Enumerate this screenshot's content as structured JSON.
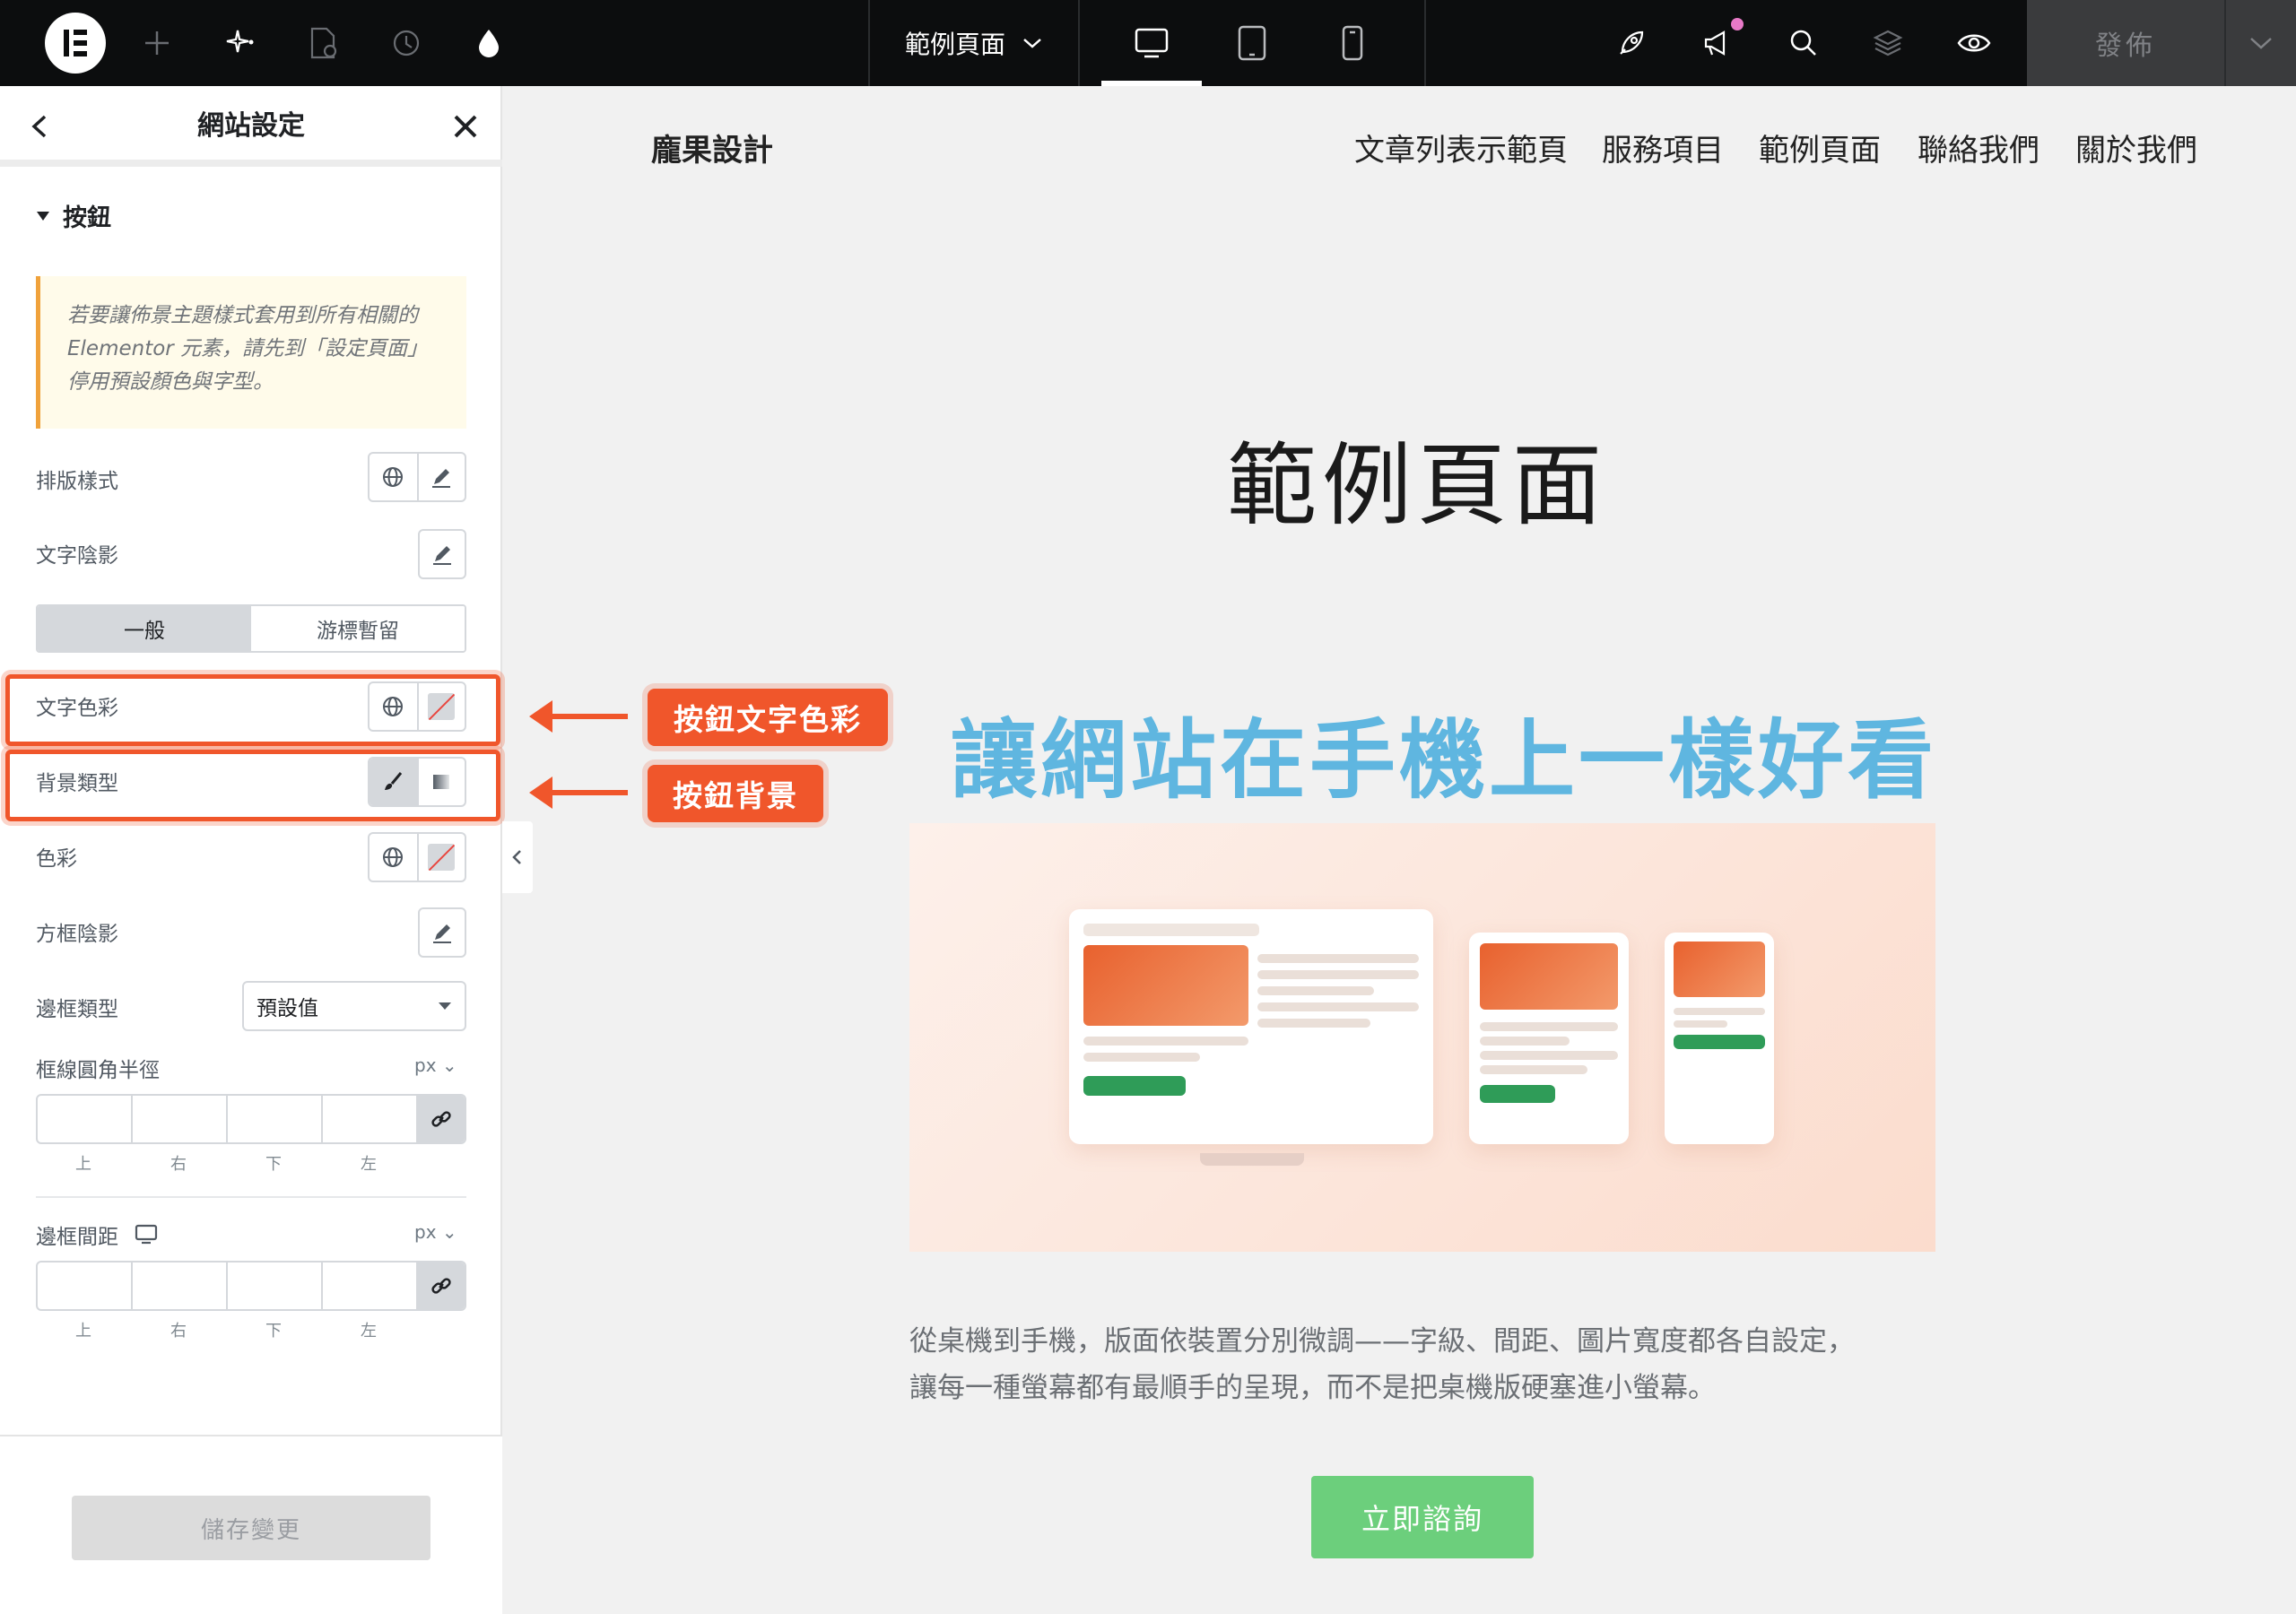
{
  "topbar": {
    "page_name": "範例頁面",
    "publish_label": "發佈"
  },
  "panel": {
    "title": "網站設定",
    "section_title": "按鈕",
    "notice": "若要讓佈景主題樣式套用到所有相關的 Elementor 元素，請先到「設定頁面」停用預設顏色與字型。",
    "typography_label": "排版樣式",
    "text_shadow_label": "文字陰影",
    "tabs": [
      "一般",
      "游標暫留"
    ],
    "text_color_label": "文字色彩",
    "background_type_label": "背景類型",
    "color_label": "色彩",
    "box_shadow_label": "方框陰影",
    "border_type_label": "邊框類型",
    "border_type_value": "預設值",
    "border_radius_label": "框線圓角半徑",
    "padding_label": "邊框間距",
    "unit": "px",
    "dim_labels": [
      "上",
      "右",
      "下",
      "左"
    ],
    "save_label": "儲存變更"
  },
  "site": {
    "brand": "龐果設計",
    "nav": [
      "文章列表示範頁",
      "服務項目",
      "範例頁面",
      "聯絡我們",
      "關於我們"
    ],
    "hero_title": "範例頁面",
    "tagline": "讓網站在手機上一樣好看",
    "paragraph_line1": "從桌機到手機，版面依裝置分別微調——字級、間距、圖片寬度都各自設定，",
    "paragraph_line2": "讓每一種螢幕都有最順手的呈現，而不是把桌機版硬塞進小螢幕。",
    "cta": "立即諮詢"
  },
  "callouts": {
    "text_color": "按鈕文字色彩",
    "background": "按鈕背景"
  },
  "colors": {
    "accent": "#f0562b",
    "tagline": "#5fb6e0",
    "cta": "#6ccf7c"
  }
}
